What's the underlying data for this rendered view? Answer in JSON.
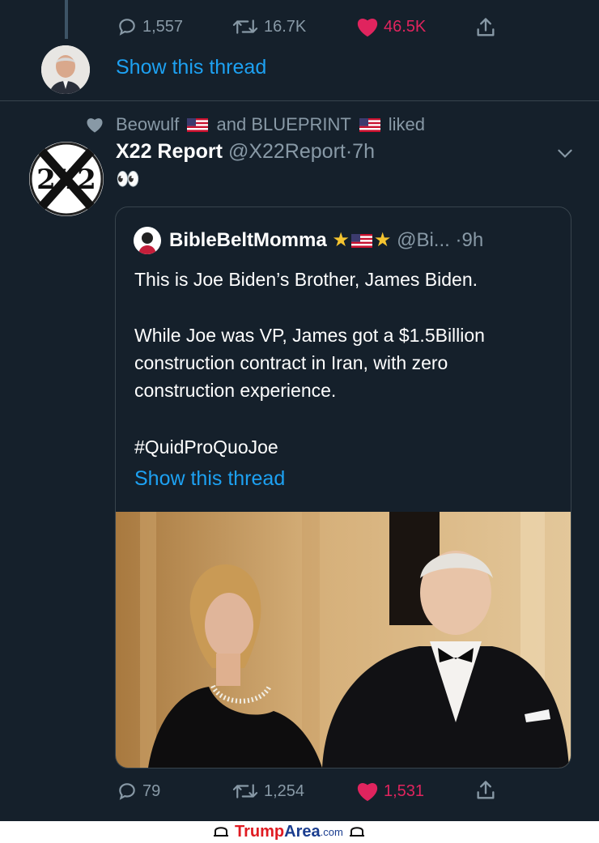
{
  "top_tweet": {
    "actions": {
      "replies": "1,557",
      "retweets": "16.7K",
      "likes": "46.5K"
    },
    "show_thread": "Show this thread"
  },
  "social_context": {
    "user1": "Beowulf",
    "connector": "and",
    "user2": "BLUEPRINT",
    "suffix": "liked"
  },
  "tweet": {
    "display_name": "X22 Report",
    "handle": "@X22Report",
    "separator": "·",
    "time": "7h",
    "body": "👀",
    "avatar_text": "2X2",
    "quoted": {
      "display_name": "BibleBeltMomma",
      "handle": "@Bi...",
      "separator": "·",
      "time": "9h",
      "line1": "This is Joe Biden’s Brother,  James Biden.",
      "para2": "While Joe was VP, James got a $1.5Billion\nconstruction contract in Iran, with zero\nconstruction experience.",
      "hashtag": "#QuidProQuoJoe",
      "show_thread": "Show this thread"
    },
    "actions": {
      "replies": "79",
      "retweets": "1,254",
      "likes": "1,531"
    }
  },
  "watermark": {
    "part1": "Trump",
    "part2": "Area",
    "part3": ".com"
  },
  "colors": {
    "background": "#15202b",
    "link": "#1da1f2",
    "like": "#e0245e",
    "muted": "#8899a6",
    "watermark_red": "#e01b22"
  }
}
